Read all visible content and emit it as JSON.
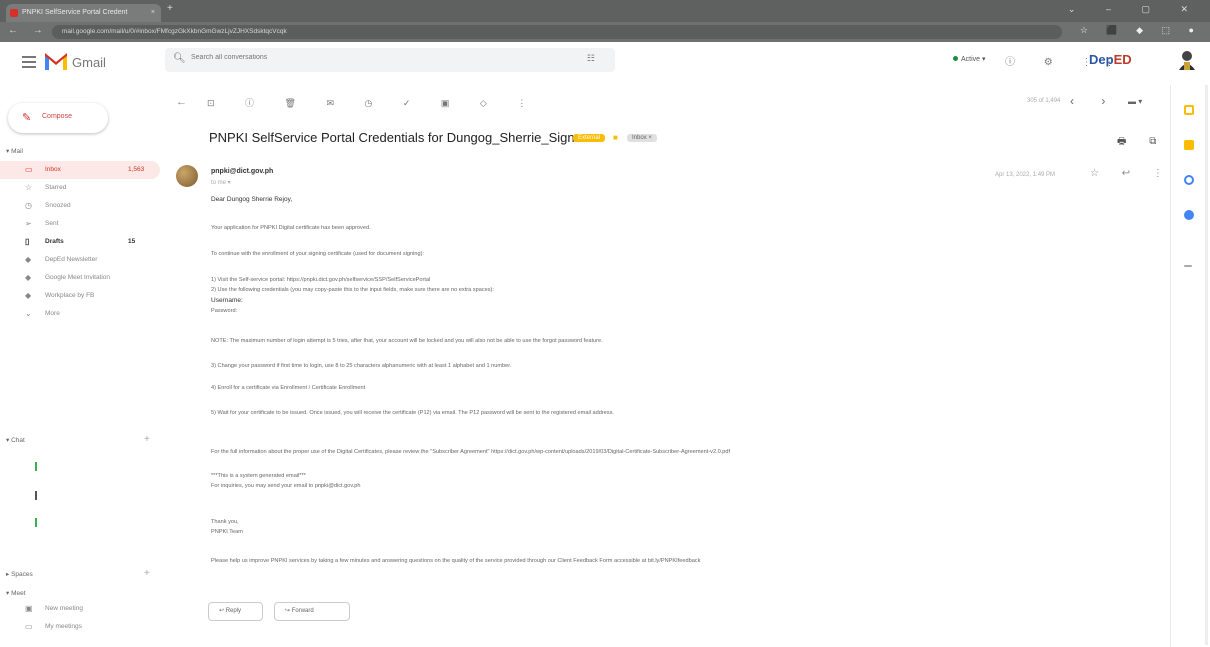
{
  "browser": {
    "tab_title": "PNPKI SelfService Portal Credent",
    "close": "×",
    "new_tab": "+",
    "address": "mail.google.com/mail/u/0/#inbox/FMfcgzGkXkbnGmGwzLjvZJHXSdsktqcVcqk"
  },
  "gmail": {
    "brand": "Gmail",
    "search_placeholder": "Search all conversations",
    "status": "Active",
    "org_logo_a": "Dep",
    "org_logo_b": "ED"
  },
  "sidebar": {
    "compose": "Compose",
    "mail_header": "Mail",
    "items": [
      {
        "label": "Inbox",
        "count": "1,563",
        "icon": "inbox-icon"
      },
      {
        "label": "Starred",
        "count": "",
        "icon": "star-icon"
      },
      {
        "label": "Snoozed",
        "count": "",
        "icon": "clock-icon"
      },
      {
        "label": "Sent",
        "count": "",
        "icon": "send-icon"
      },
      {
        "label": "Drafts",
        "count": "15",
        "icon": "file-icon"
      },
      {
        "label": "DepEd Newsletter",
        "count": "",
        "icon": "label-icon"
      },
      {
        "label": "Google Meet Invitation",
        "count": "",
        "icon": "label-icon"
      },
      {
        "label": "Workplace by FB",
        "count": "",
        "icon": "label-icon"
      },
      {
        "label": "More",
        "count": "",
        "icon": "chevron-down-icon"
      }
    ],
    "chat_header": "Chat",
    "spaces_header": "Spaces",
    "meet_header": "Meet",
    "meet_items": [
      {
        "label": "New meeting",
        "icon": "video-icon"
      },
      {
        "label": "My meetings",
        "icon": "calendar-icon"
      }
    ]
  },
  "toolbar": {
    "pager": "305 of 1,494"
  },
  "message": {
    "subject": "PNPKI SelfService Portal Credentials for Dungog_Sherrie_Sign",
    "label_external": "External",
    "label_inbox": "Inbox ×",
    "sender": "pnpki@dict.gov.ph",
    "to": "to me ▾",
    "date": "Apr 13, 2022, 1:49 PM",
    "lines": [
      {
        "text": "Dear Dungog Sherrie Rejoy,"
      },
      {
        "text": "Your application for PNPKI Digital certificate has been approved."
      },
      {
        "text": "To continue with the enrollment of your signing certificate (used for document signing):"
      },
      {
        "text": "1) Visit the Self-service portal: https://pnpki.dict.gov.ph/selfservice/SSP/SelfServicePortal"
      },
      {
        "text": "2) Use the following credentials (you may copy-paste this to the input fields, make sure there are no extra spaces):"
      },
      {
        "text": "Username: "
      },
      {
        "text": "Password: "
      },
      {
        "text": "NOTE: The maximum number of login attempt is 5 tries, after that, your account will be locked and you will also not be able to use the forgot password feature."
      },
      {
        "text": "3) Change your password if first time to login, use 8 to 25 characters alphanumeric with at least 1 alphabet and 1 number."
      },
      {
        "text": "4) Enroll for a certificate via Enrollment / Certificate Enrollment"
      },
      {
        "text": "5) Wait for your certificate to be issued. Once issued, you will receive the certificate (P12) via email. The P12 password will be sent to the registered email address."
      },
      {
        "text": "For the full information about the proper use of the Digital Certificates, please review the \"Subscriber Agreement\" https://dict.gov.ph/wp-content/uploads/2019/03/Digital-Certificate-Subscriber-Agreement-v2.0.pdf"
      },
      {
        "text": "***This is a system generated email***"
      },
      {
        "text": "For inquiries, you may send your email to pnpki@dict.gov.ph"
      },
      {
        "text": "Thank you,"
      },
      {
        "text": "PNPKI Team"
      },
      {
        "text": "Please help us improve PNPKI services by taking a few minutes and answering questions on the quality of the service provided through our Client Feedback Form accessible at bit.ly/PNPKIfeedback"
      }
    ],
    "reply": "Reply",
    "forward": "Forward"
  }
}
